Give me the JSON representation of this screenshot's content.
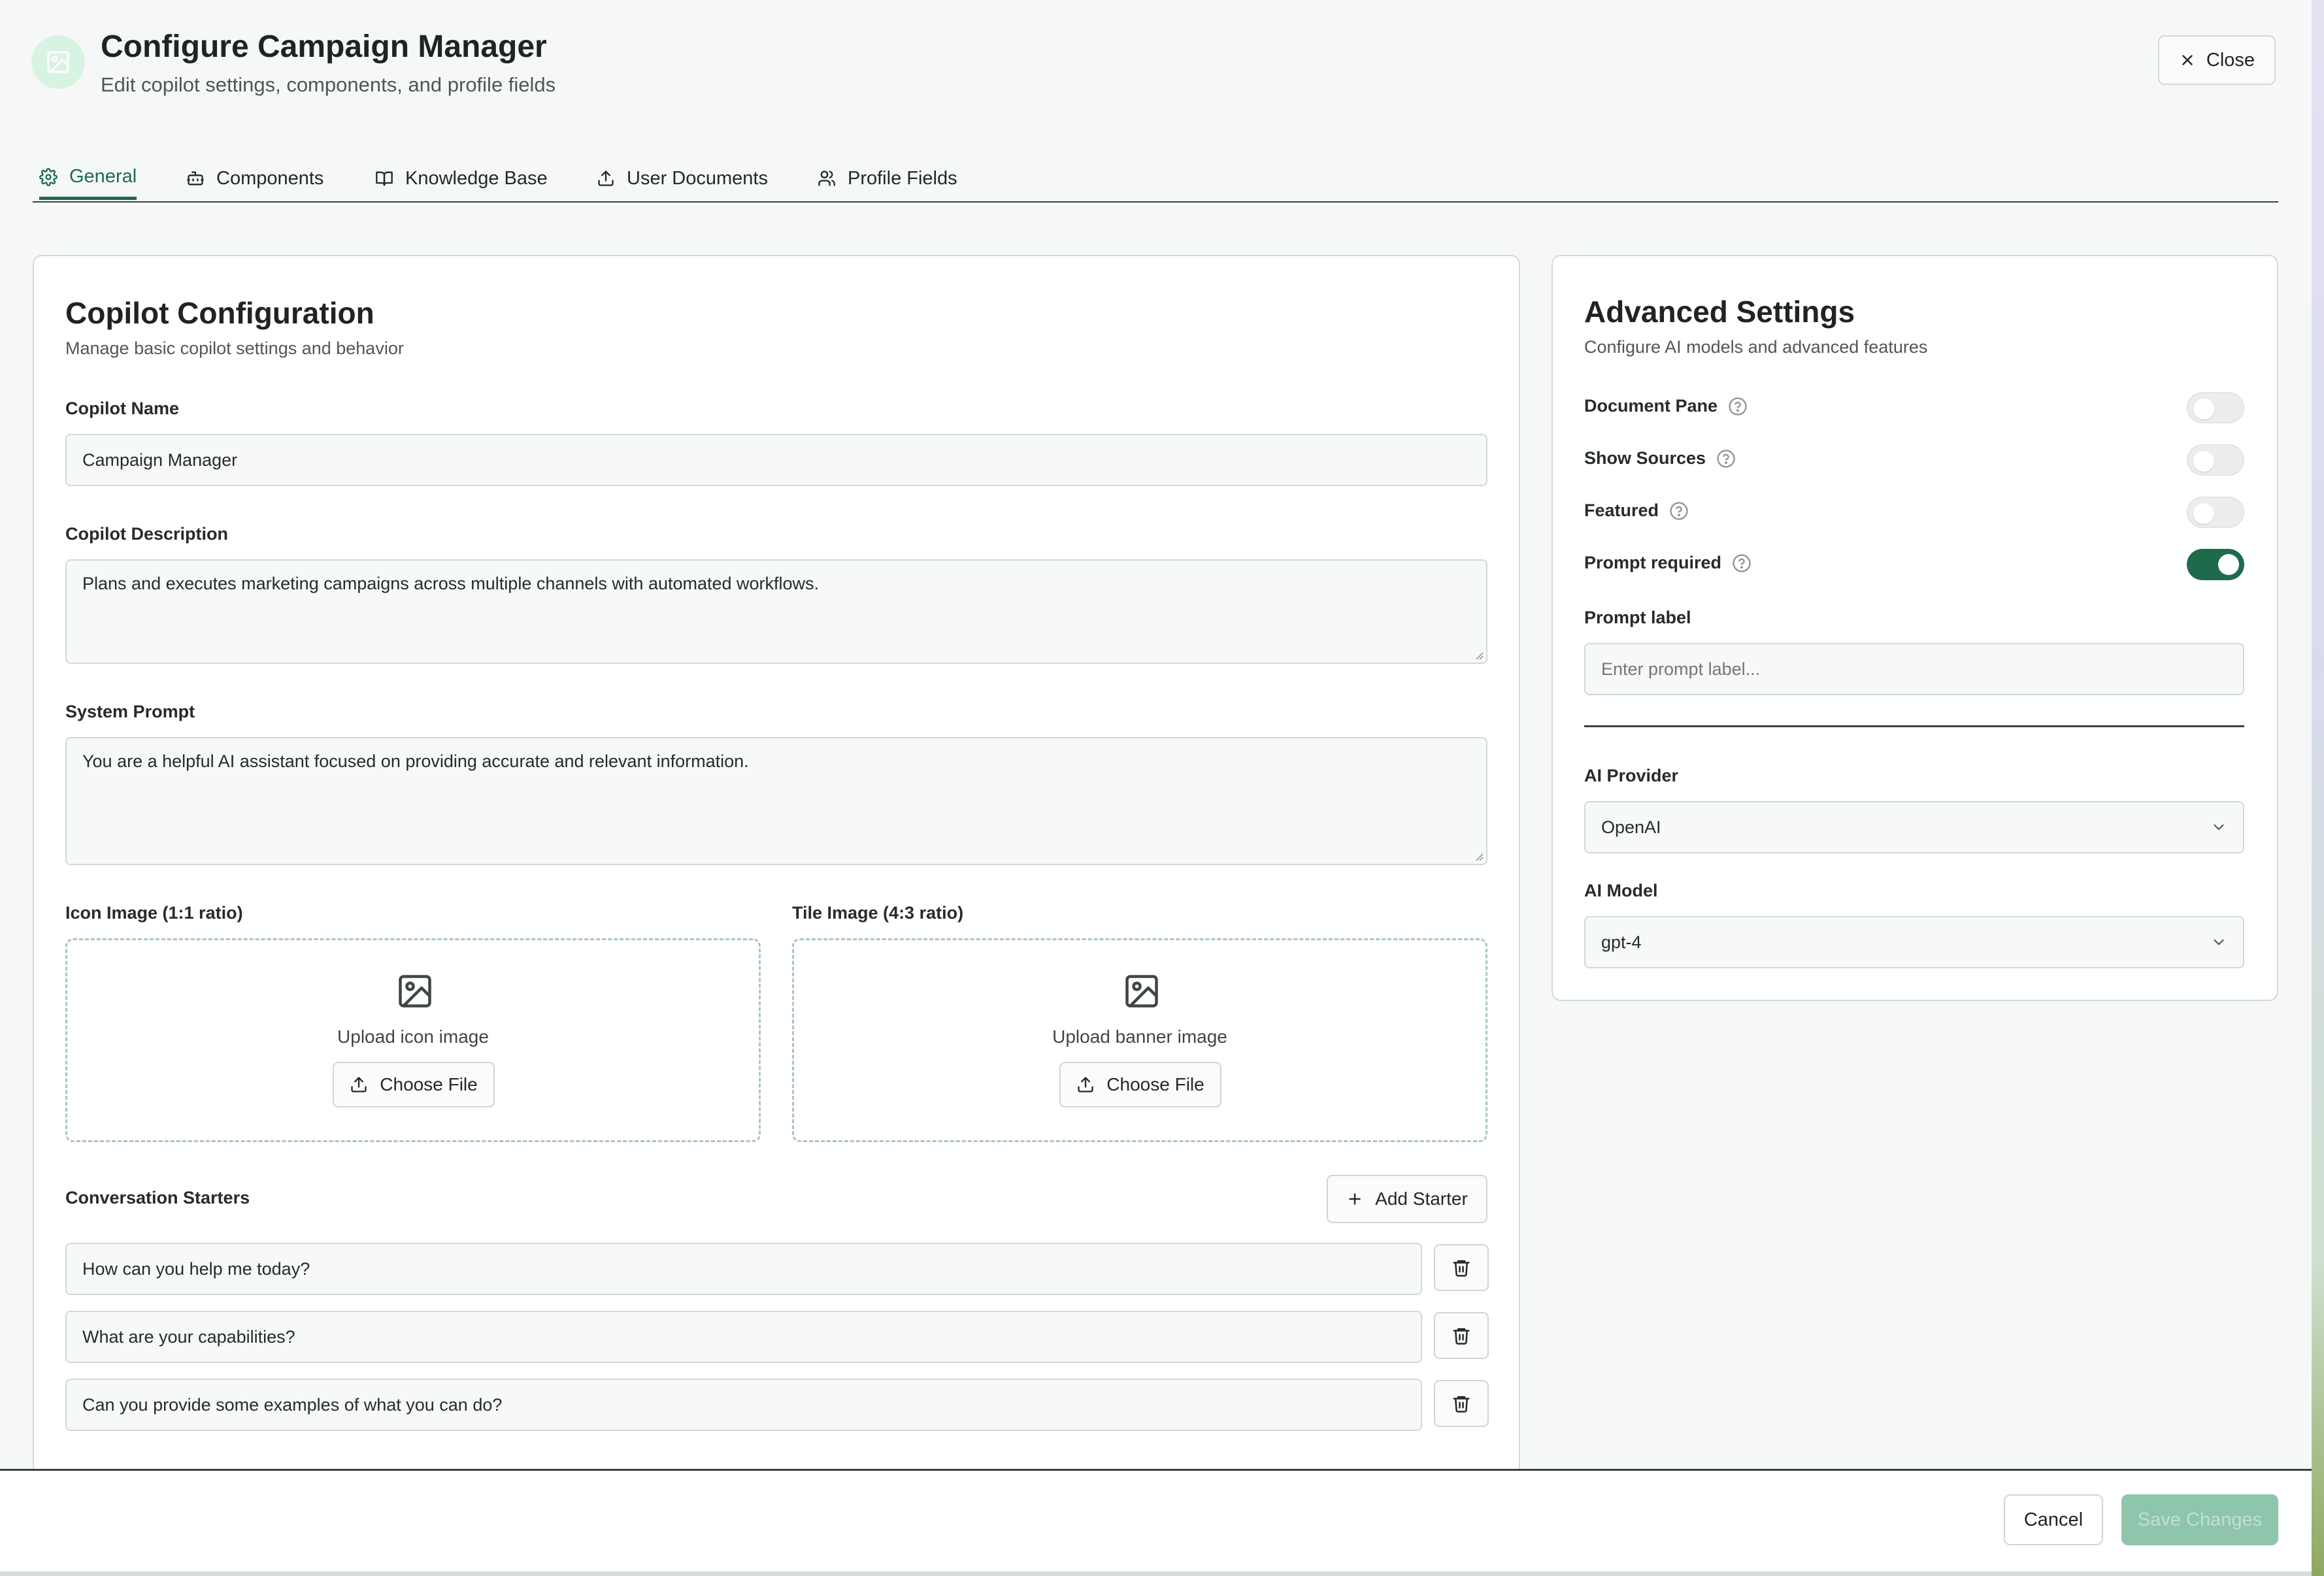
{
  "header": {
    "title": "Configure Campaign Manager",
    "subtitle": "Edit copilot settings, components, and profile fields",
    "avatar_icon": "image-icon",
    "close_label": "Close"
  },
  "tabs": [
    {
      "label": "General",
      "icon": "gear-icon",
      "active": true
    },
    {
      "label": "Components",
      "icon": "bot-icon",
      "active": false
    },
    {
      "label": "Knowledge Base",
      "icon": "book-icon",
      "active": false
    },
    {
      "label": "User Documents",
      "icon": "upload-icon",
      "active": false
    },
    {
      "label": "Profile Fields",
      "icon": "users-icon",
      "active": false
    }
  ],
  "config": {
    "title": "Copilot Configuration",
    "subtitle": "Manage basic copilot settings and behavior",
    "name_label": "Copilot Name",
    "name_value": "Campaign Manager",
    "description_label": "Copilot Description",
    "description_value": "Plans and executes marketing campaigns across multiple channels with automated workflows.",
    "prompt_label": "System Prompt",
    "prompt_value": "You are a helpful AI assistant focused on providing accurate and relevant information.",
    "icon_image_label": "Icon Image (1:1 ratio)",
    "icon_upload_text": "Upload icon image",
    "tile_image_label": "Tile Image (4:3 ratio)",
    "tile_upload_text": "Upload banner image",
    "choose_file_label": "Choose File",
    "starters_label": "Conversation Starters",
    "add_starter_label": "Add Starter",
    "starters": [
      "How can you help me today?",
      "What are your capabilities?",
      "Can you provide some examples of what you can do?"
    ]
  },
  "advanced": {
    "title": "Advanced Settings",
    "subtitle": "Configure AI models and advanced features",
    "toggles": [
      {
        "label": "Document Pane",
        "on": false
      },
      {
        "label": "Show Sources",
        "on": false
      },
      {
        "label": "Featured",
        "on": false
      },
      {
        "label": "Prompt required",
        "on": true
      }
    ],
    "prompt_label_label": "Prompt label",
    "prompt_label_placeholder": "Enter prompt label...",
    "provider_label": "AI Provider",
    "provider_value": "OpenAI",
    "model_label": "AI Model",
    "model_value": "gpt-4"
  },
  "footer": {
    "cancel_label": "Cancel",
    "save_label": "Save Changes"
  },
  "colors": {
    "accent": "#1e6b4c",
    "save_disabled": "#8fc4ad",
    "card_border": "#cfdcd6"
  }
}
